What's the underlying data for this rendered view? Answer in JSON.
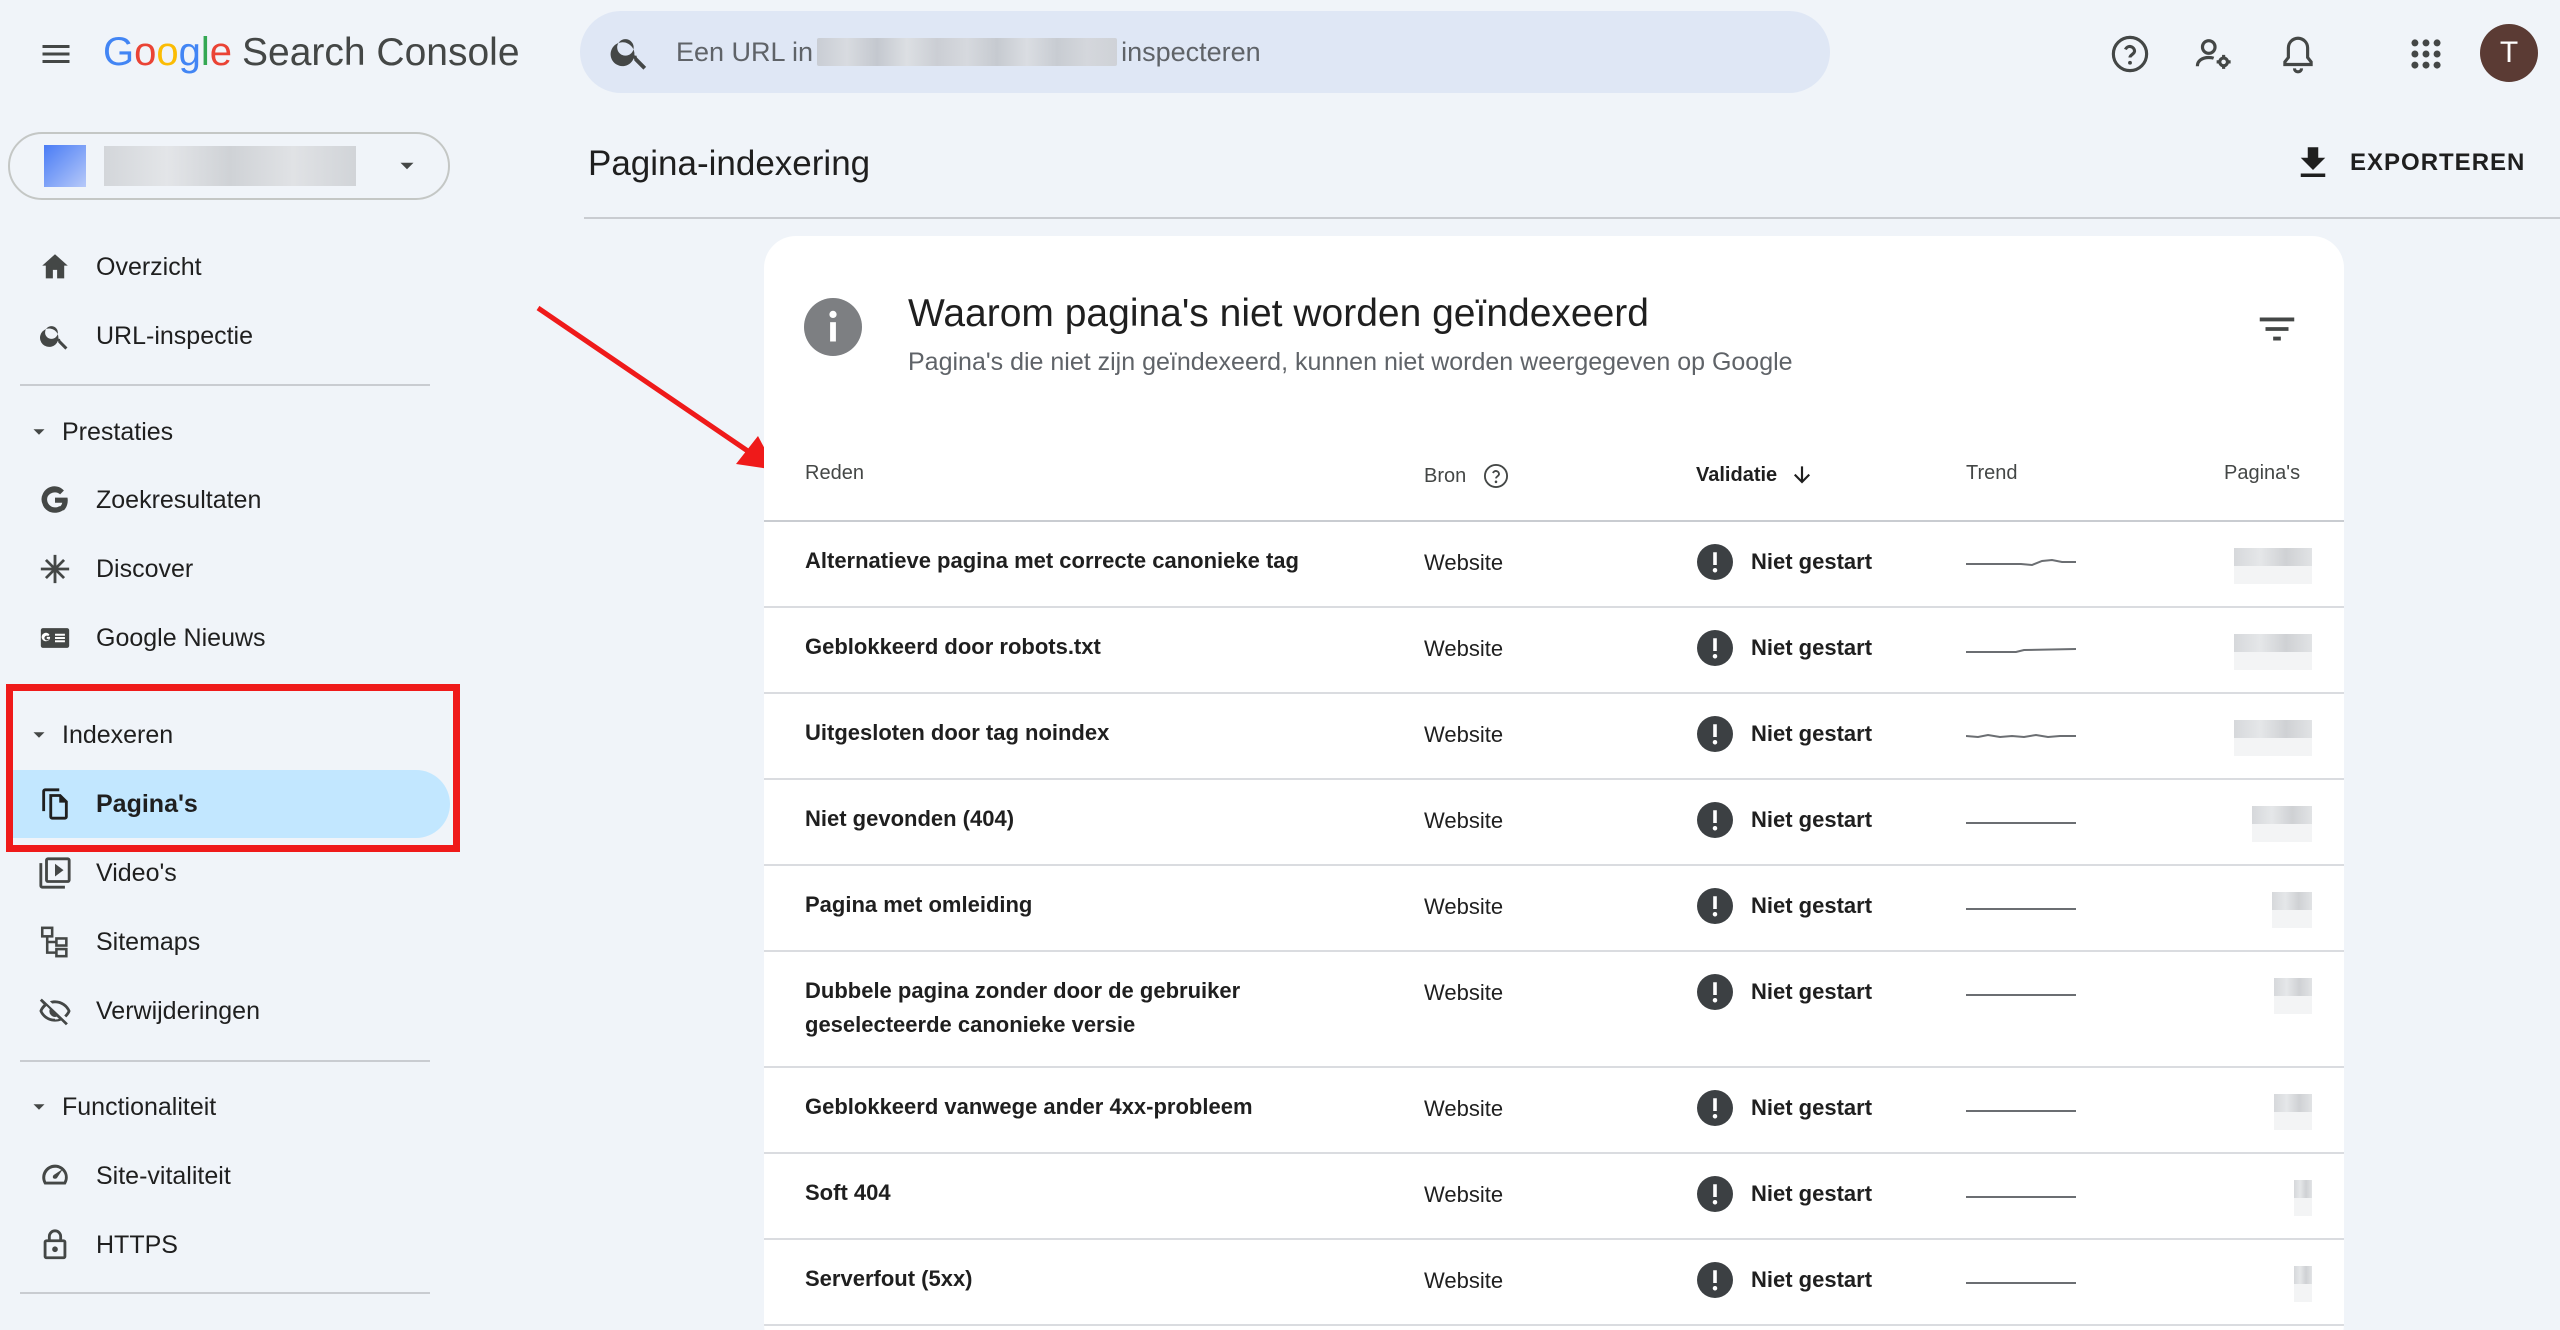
{
  "app": {
    "logo_google": [
      "G",
      "o",
      "o",
      "g",
      "l",
      "e"
    ],
    "logo_colors": [
      "#4285F4",
      "#EA4335",
      "#FBBC05",
      "#4285F4",
      "#34A853",
      "#EA4335"
    ],
    "product_name": "Search Console"
  },
  "search": {
    "prefix": "Een URL in",
    "suffix": "inspecteren"
  },
  "user": {
    "initial": "T",
    "avatar_color": "#5b3b34"
  },
  "topbar_icons": [
    "help-icon",
    "manage-users-icon",
    "notifications-icon",
    "apps-grid-icon"
  ],
  "sidebar": {
    "top_items": [
      {
        "label": "Overzicht",
        "icon": "home-icon"
      },
      {
        "label": "URL-inspectie",
        "icon": "search-icon"
      }
    ],
    "sections": [
      {
        "title": "Prestaties",
        "items": [
          {
            "label": "Zoekresultaten",
            "icon": "google-g-icon"
          },
          {
            "label": "Discover",
            "icon": "asterisk-icon"
          },
          {
            "label": "Google Nieuws",
            "icon": "google-news-icon"
          }
        ]
      },
      {
        "title": "Indexeren",
        "items": [
          {
            "label": "Pagina's",
            "icon": "pages-icon",
            "active": true
          },
          {
            "label": "Video's",
            "icon": "video-icon"
          },
          {
            "label": "Sitemaps",
            "icon": "sitemap-icon"
          },
          {
            "label": "Verwijderingen",
            "icon": "visibility-off-icon"
          }
        ]
      },
      {
        "title": "Functionaliteit",
        "items": [
          {
            "label": "Site-vitaliteit",
            "icon": "speed-icon"
          },
          {
            "label": "HTTPS",
            "icon": "lock-icon"
          }
        ]
      }
    ],
    "highlight_color": "#ef1a1a",
    "active_color": "#c2e7ff"
  },
  "main": {
    "page_title": "Pagina-indexering",
    "export_label": "EXPORTEREN",
    "card": {
      "title": "Waarom pagina's niet worden geïndexeerd",
      "subtitle": "Pagina's die niet zijn geïndexeerd, kunnen niet worden weergegeven op Google",
      "columns": {
        "reason": "Reden",
        "source": "Bron",
        "validation": "Validatie",
        "trend": "Trend",
        "pages": "Pagina's"
      },
      "rows": [
        {
          "reason": [
            "Alternatieve pagina met correcte canonieke tag"
          ],
          "source": "Website",
          "status": "Niet gestart",
          "trend": "slight-bump"
        },
        {
          "reason": [
            "Geblokkeerd door robots.txt"
          ],
          "source": "Website",
          "status": "Niet gestart",
          "trend": "slight-step"
        },
        {
          "reason": [
            "Uitgesloten door tag noindex"
          ],
          "source": "Website",
          "status": "Niet gestart",
          "trend": "wavy"
        },
        {
          "reason": [
            "Niet gevonden (404)"
          ],
          "source": "Website",
          "status": "Niet gestart",
          "trend": "flat"
        },
        {
          "reason": [
            "Pagina met omleiding"
          ],
          "source": "Website",
          "status": "Niet gestart",
          "trend": "flat"
        },
        {
          "reason": [
            "Dubbele pagina zonder door de gebruiker",
            "geselecteerde canonieke versie"
          ],
          "source": "Website",
          "status": "Niet gestart",
          "trend": "flat"
        },
        {
          "reason": [
            "Geblokkeerd vanwege ander 4xx-probleem"
          ],
          "source": "Website",
          "status": "Niet gestart",
          "trend": "flat"
        },
        {
          "reason": [
            "Soft 404"
          ],
          "source": "Website",
          "status": "Niet gestart",
          "trend": "flat"
        },
        {
          "reason": [
            "Serverfout (5xx)"
          ],
          "source": "Website",
          "status": "Niet gestart",
          "trend": "flat"
        }
      ]
    }
  },
  "annotation": {
    "arrow_color": "#ef1a1a"
  }
}
